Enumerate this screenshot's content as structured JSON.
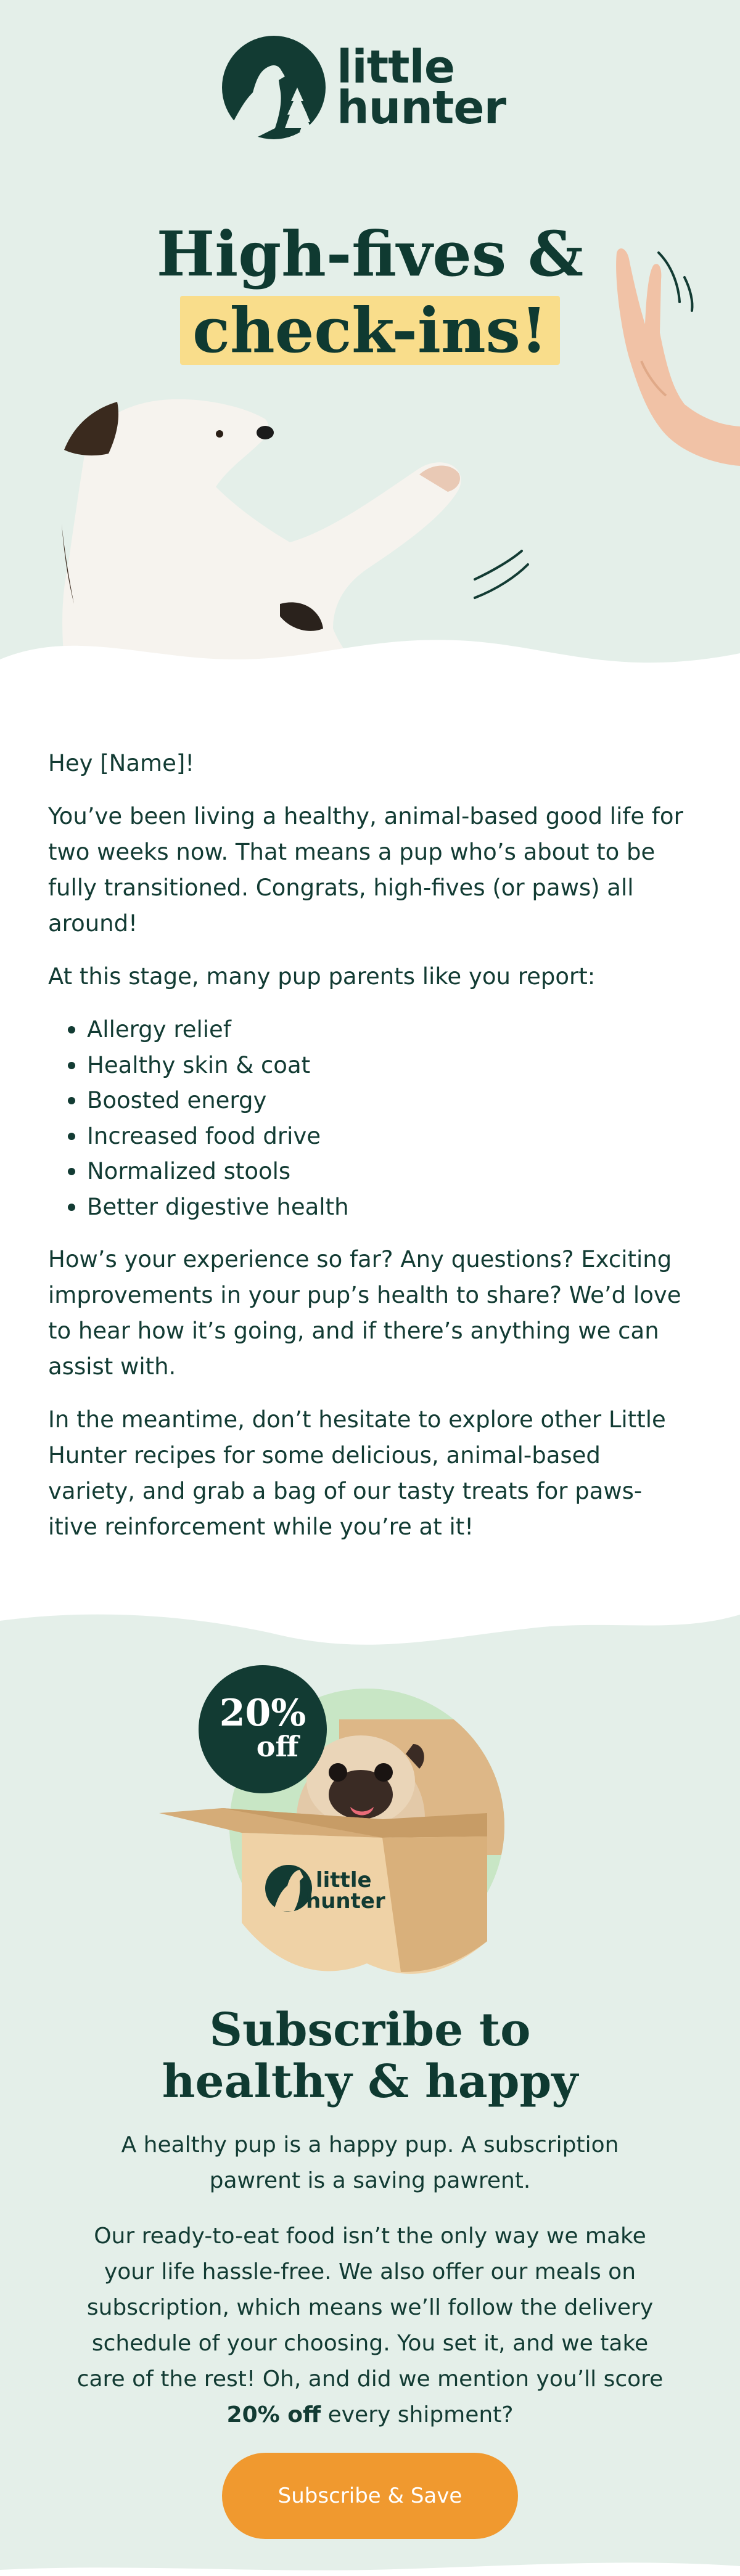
{
  "brand": {
    "logo_line1": "little",
    "logo_line2": "hunter",
    "dark_green": "#0f3a31",
    "mint_bg": "#e4efe9",
    "highlight_yellow": "#f9dd8b",
    "cta_orange": "#f0992f"
  },
  "hero": {
    "title_line1": "High-fives &",
    "title_line2": "check-ins!",
    "icons": [
      "dog-high-five-photo",
      "human-hand-icon",
      "motion-lines-icon"
    ]
  },
  "body": {
    "greeting": "Hey [Name]!",
    "paragraph1": "You’ve been living a healthy, animal-based good life for two weeks now. That means a pup who’s about to be fully transitioned. Congrats, high-fives (or paws) all around!",
    "list_intro": "At this stage, many pup parents like you report:",
    "benefits": [
      "Allergy relief",
      "Healthy skin & coat",
      "Boosted energy",
      "Increased food drive",
      "Normalized stools",
      "Better digestive health"
    ],
    "paragraph2": "How’s your experience so far? Any questions? Exciting improvements in your pup’s health to share? We’d love to hear how it’s going, and if there’s anything we can assist with.",
    "paragraph3": "In the meantime, don’t hesitate to explore other Little Hunter recipes for some delicious, animal-based variety, and grab a bag of our tasty treats for paws-itive reinforcement while you’re at it!"
  },
  "promo": {
    "badge_percent": "20%",
    "badge_off": "off",
    "box_logo_line1": "little",
    "box_logo_line2": "hunter",
    "title_line1": "Subscribe to",
    "title_line2": "healthy & happy",
    "intro": "A healthy pup is a happy pup. A subscription pawrent is a saving pawrent.",
    "text_before_bold": "Our ready-to-eat food isn’t the only way we make your life hassle-free. We also offer our meals on subscription, which means we’ll follow the delivery schedule of your choosing. You set it, and we take care of the rest! Oh, and did we mention you’ll score ",
    "text_bold": "20% off",
    "text_after_bold": " every shipment?",
    "cta_label": "Subscribe & Save"
  }
}
